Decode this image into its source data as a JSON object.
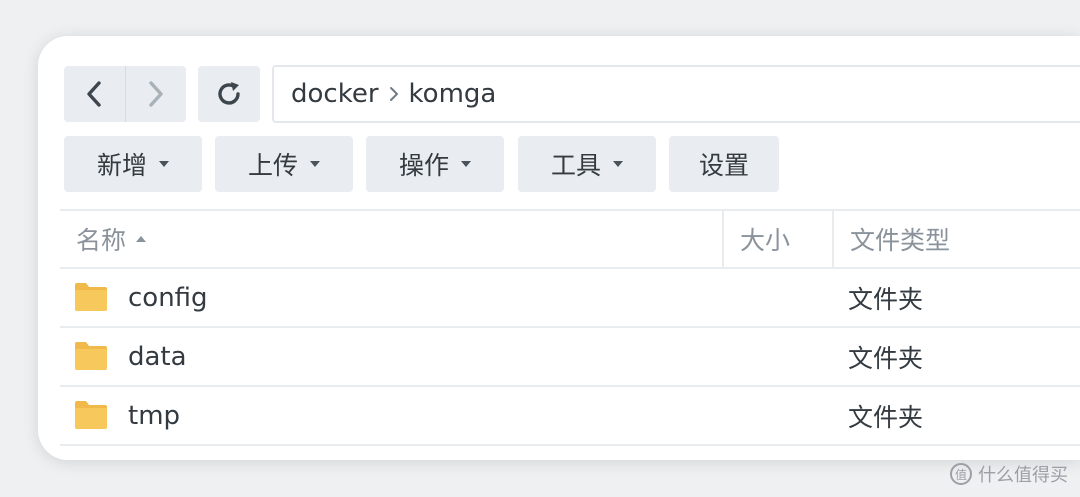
{
  "nav": {
    "back_icon": "chevron-left-icon",
    "forward_icon": "chevron-right-icon",
    "refresh_icon": "refresh-icon"
  },
  "path": {
    "segments": [
      "docker",
      "komga"
    ]
  },
  "toolbar": {
    "create_label": "新增",
    "upload_label": "上传",
    "action_label": "操作",
    "tools_label": "工具",
    "settings_label": "设置"
  },
  "table": {
    "columns": {
      "name": "名称",
      "size": "大小",
      "type": "文件类型"
    },
    "rows": [
      {
        "name": "config",
        "size": "",
        "type": "文件夹"
      },
      {
        "name": "data",
        "size": "",
        "type": "文件夹"
      },
      {
        "name": "tmp",
        "size": "",
        "type": "文件夹"
      }
    ]
  },
  "watermark": {
    "logo": "值",
    "text": "什么值得买"
  },
  "colors": {
    "folder": "#f7c95c",
    "folder_tab": "#f0b94a",
    "button_bg": "#e9edf1"
  }
}
